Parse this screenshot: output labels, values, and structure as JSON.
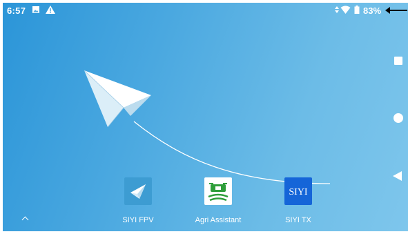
{
  "status_bar": {
    "time": "6:57",
    "left_icons": [
      "image-icon",
      "warning-icon"
    ],
    "right_icons": [
      "data-arrows-icon",
      "wifi-icon",
      "battery-icon"
    ],
    "battery_percent": "83%"
  },
  "apps": [
    {
      "label": "SIYI FPV",
      "icon": "paper-plane-icon"
    },
    {
      "label": "Agri Assistant",
      "icon": "drone-field-icon"
    },
    {
      "label": "SIYI TX",
      "icon": "siyi-logo-icon",
      "icon_text": "SIYI"
    }
  ],
  "nav_bar": {
    "buttons": [
      "recents-button",
      "home-button",
      "back-button"
    ]
  },
  "colors": {
    "wallpaper_start": "#2b95d8",
    "wallpaper_end": "#7ec6ec",
    "fpv_icon_bg": "#3d9cd2",
    "agri_icon_green": "#2e9e3a",
    "siyi_icon_bg": "#1565d8"
  }
}
